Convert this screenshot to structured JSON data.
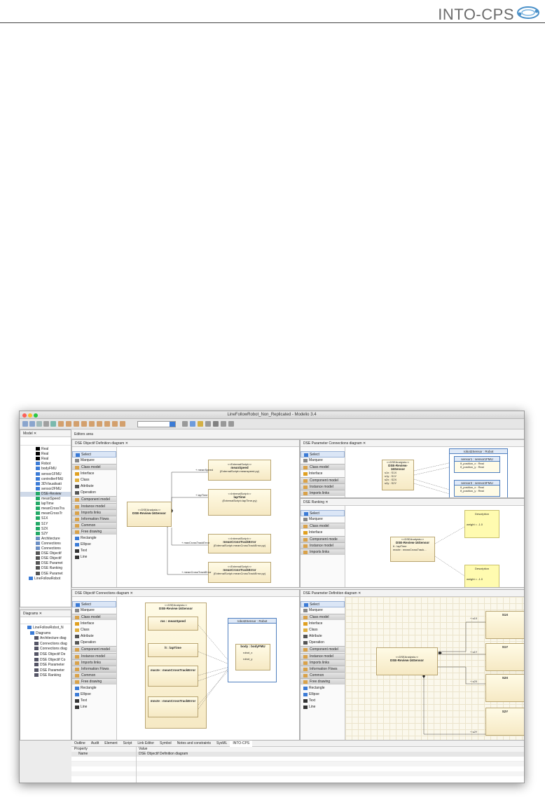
{
  "header": {
    "brand": "INTO-CPS"
  },
  "window": {
    "title": "LineFollowRobot_Non_Replicated - Modelio 3.4"
  },
  "model_tab": "Model",
  "diagrams_tab": "Diagrams",
  "tree_items": [
    "Real",
    "Real",
    "Real",
    "Robot",
    "bodyFMU",
    "sensor1FMU",
    "controllerFMU",
    "3DVisualisati",
    "sensor2FMU",
    "DSE-Review",
    "meanSpeed",
    "lapTime",
    "meanCrossTra",
    "meanCrossTr",
    "S1X",
    "S1Y",
    "S2X",
    "S2Y",
    "Architecture",
    "Connections",
    "Connections",
    "DSE Objectif",
    "DSE Objectif",
    "DSE Paramet",
    "DSE Ranking",
    "DSE Paramet",
    "LineFollowRobot"
  ],
  "diagram_tree": [
    "LineFollowRobot_N",
    "Diagrams",
    "Architecture diag",
    "Connections diag",
    "Connections diag",
    "DSE Objectif De",
    "DSE Objectif Co",
    "DSE Parameter",
    "DSE Parameter",
    "DSE Ranking"
  ],
  "editors_area": "Editors area",
  "tabs": {
    "def": "DSE Objectif Definition diagram",
    "conn": "DSE Objectif Connections diagram",
    "pconn": "DSE Parameter Connections diagram",
    "rank": "DSE Ranking",
    "pdef": "DSE Parameter Definition diagram"
  },
  "palette_full": [
    "Select",
    "Marquee",
    "Class model",
    "Interface",
    "Class",
    "Attribute",
    "Operation",
    "Component model",
    "Instance model",
    "Imports links",
    "Information Flows",
    "Common",
    "Free drawing",
    "Rectangle",
    "Ellipse",
    "Text",
    "Line"
  ],
  "palette_short": [
    "Select",
    "Marquee",
    "Class model",
    "Interface",
    "Component model",
    "Instance model",
    "Imports links"
  ],
  "palette_rank": [
    "Select",
    "Marquee",
    "Class model",
    "Interface",
    "Component mode",
    "Instance model",
    "Imports links"
  ],
  "palette_pdef": [
    "Select",
    "Marquee",
    "Class model",
    "Interface",
    "Class",
    "Attribute",
    "Operation",
    "Component model",
    "Instance model",
    "Imports links",
    "Information Flows",
    "Common",
    "Free drawing",
    "Rectangle",
    "Ellipse",
    "Text",
    "Line"
  ],
  "def_diagram": {
    "main": {
      "stereo": "<<DSEAnalysis>>",
      "name": "DSE-Review-16Sensor"
    },
    "boxes": [
      {
        "stereo": "<<ExternalScript>>",
        "name": "meanSpeed",
        "sub": "(ExternalScript=meanspeed.py)"
      },
      {
        "stereo": "<<InternalScript>>",
        "name": "lapTime",
        "sub": "(ExternalScript=lapTime.py)"
      },
      {
        "stereo": "<<InternalScript>>",
        "name": "meanCrossTrackError",
        "sub": "(ExternalScript=meanCrossTrackError.py)"
      },
      {
        "stereo": "<<ExternalScript>>",
        "name": "meanCrossTrackError",
        "sub": "(ExternalScript=meanCrossTrackError.py)"
      }
    ],
    "links": [
      "+ meanSpeed",
      "+ lapTime",
      "+ maxCrossTrackError",
      "+ meanCrossTrackError"
    ]
  },
  "conn_diagram": {
    "outer": {
      "stereo": "<<DSEAnalysis>>",
      "name": "DSE-Review-16Sensor"
    },
    "inner": [
      "ms : meanSpeed",
      "lt : lapTime",
      "mxcte : meanCrossTrackError",
      "mncte : meanCrossTrackError"
    ],
    "robot": {
      "title": "robot2Sensor : Robot",
      "body": "body : bodyFMU",
      "ports": [
        "robot_x",
        "robot_y"
      ]
    }
  },
  "pconn_diagram": {
    "main": {
      "stereo": "<<DSEAnalysis>>",
      "name": "DSE-Review-16Sensor",
      "attrs": [
        "s1x : S1X",
        "s1y : S1Y",
        "s2x : S2X",
        "s2y : S2Y"
      ]
    },
    "robot": "robot2Sensor : Robot",
    "sensors": [
      {
        "name": "sensor1 : sensor1FMU",
        "vals": [
          "lf_position_x : Real",
          "lf_position_y : Real"
        ]
      },
      {
        "name": "sensor2 : sensor2FMU",
        "vals": [
          "lf_position_x : Real",
          "lf_position_y : Real"
        ]
      }
    ]
  },
  "rank_diagram": {
    "main": {
      "stereo": "<<DSEAnalysis>>",
      "name": "DSE-Review-16Sensor",
      "attrs": [
        "lt : lapTime",
        "mxcte : meanCrossTrack..."
      ]
    },
    "notes": [
      {
        "title": "Description",
        "body": "weight = -1.0"
      },
      {
        "title": "Description",
        "body": "weight = -1.0"
      }
    ]
  },
  "pdef_diagram": {
    "main": {
      "stereo": "<<DSEAnalysis>>",
      "name": "DSE-Review-16Sensor"
    },
    "boxes": [
      "S1X",
      "S1Y",
      "S2X",
      "S2Y"
    ],
    "links": [
      "+ s1X",
      "+ s1Y",
      "+ s2X",
      "+ s2Y"
    ]
  },
  "bottom_tabs": [
    "Outline",
    "Audit",
    "Element",
    "Script",
    "Link Editor",
    "Symbol",
    "Notes and constraints",
    "SysML",
    "INTO-CPS"
  ],
  "props": {
    "h1": "Property",
    "h2": "Value",
    "name_label": "Name",
    "name_value": "DSE Objectif Definition diagram"
  }
}
